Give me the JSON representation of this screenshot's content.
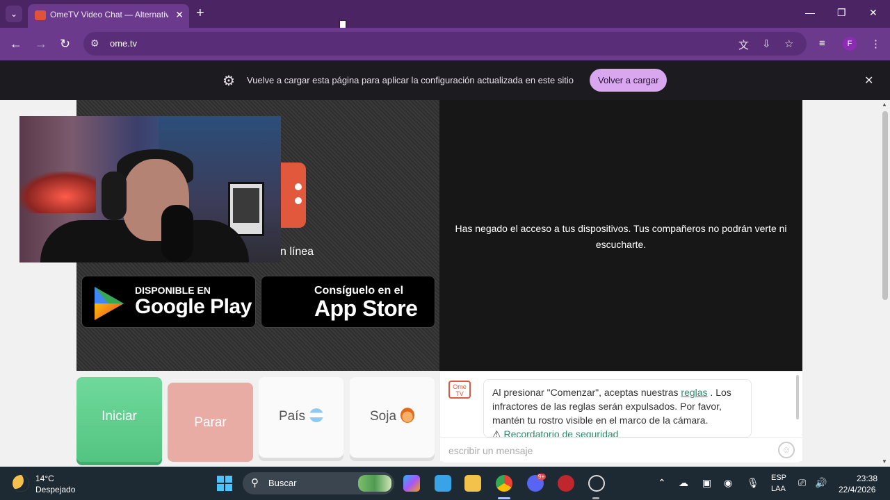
{
  "browser": {
    "tab_title": "OmeTV Video Chat — Alternativ",
    "new_tab_glyph": "+",
    "tab_close_glyph": "✕",
    "url": "ome.tv",
    "profile_letter": "F",
    "window_controls": {
      "minimize": "—",
      "restore": "❐",
      "close": "✕"
    },
    "nav": {
      "back": "←",
      "forward": "→",
      "reload": "↻"
    }
  },
  "infobar": {
    "message": "Vuelve a cargar esta página para aplicar la configuración actualizada en este sitio",
    "reload_button": "Volver a cargar",
    "close_glyph": "✕"
  },
  "page": {
    "online_text": "n línea",
    "google_play": {
      "small": "DISPONIBLE EN",
      "big": "Google Play"
    },
    "app_store": {
      "small": "Consíguelo en el",
      "big": "App Store"
    },
    "partner_notice": "Has negado el acceso a tus dispositivos. Tus compañeros no podrán verte ni escucharte.",
    "controls": {
      "start": "Iniciar",
      "stop": "Parar",
      "country": "País",
      "gender": "Soja"
    },
    "chat": {
      "logo_text_1": "Ome",
      "logo_text_2": "TV",
      "intro_before_link": "Al presionar \"Comenzar\", aceptas nuestras ",
      "rules_link": "reglas",
      "intro_after_link": " . Los infractores de las reglas serán expulsados. Por favor, mantén tu rostro visible en el marco de la cámara.",
      "safety_reminder": "Recordatorio de seguridad",
      "input_placeholder": "escribir un mensaje"
    }
  },
  "taskbar": {
    "temperature": "14°C",
    "condition": "Despejado",
    "search_label": "Buscar",
    "lang_line1": "ESP",
    "lang_line2": "LAA",
    "time": "23:38",
    "date": "22/4/2026",
    "discord_badge": "9+"
  },
  "colors": {
    "browser_frame": "#4a2463",
    "toolbar": "#6b3a8d",
    "reload_button": "#d9a7f0",
    "start_button": "#5fcf8d",
    "stop_button": "#e8aca5",
    "ome_red": "#e2583d",
    "taskbar": "#1e2a33"
  }
}
